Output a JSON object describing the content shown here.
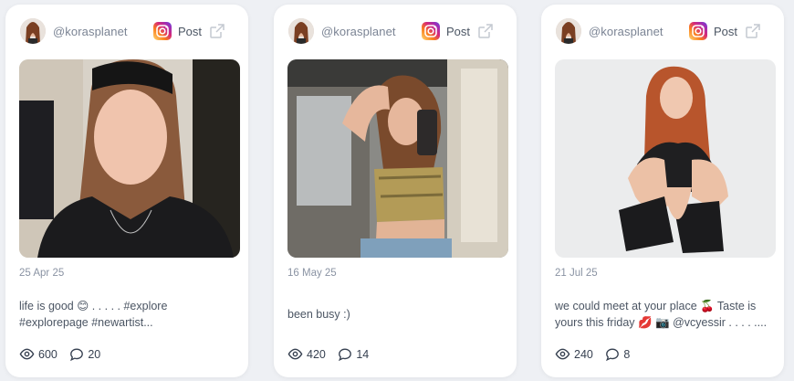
{
  "colors": {
    "page_bg": "#eef0f4",
    "card_bg": "#ffffff",
    "muted_text": "#7b8494",
    "instagram_gradient": [
      "#feda75",
      "#fa7e1e",
      "#d62976",
      "#962fbf",
      "#4f5bd5"
    ]
  },
  "posts": [
    {
      "handle": "@korasplanet",
      "source_icon": "instagram-icon",
      "post_label": "Post",
      "open_icon": "external-link-icon",
      "date": "25 Apr 25",
      "caption": "life is good 😊 . . . . . #explore #explorepage #newartist...",
      "views": "600",
      "comments": "20"
    },
    {
      "handle": "@korasplanet",
      "source_icon": "instagram-icon",
      "post_label": "Post",
      "open_icon": "external-link-icon",
      "date": "16 May 25",
      "caption": "been busy :)",
      "views": "420",
      "comments": "14"
    },
    {
      "handle": "@korasplanet",
      "source_icon": "instagram-icon",
      "post_label": "Post",
      "open_icon": "external-link-icon",
      "date": "21 Jul 25",
      "caption": "we could meet at your place 🍒 Taste is yours this friday 💋 📷 @vcyessir . . . . ....",
      "views": "240",
      "comments": "8"
    }
  ]
}
